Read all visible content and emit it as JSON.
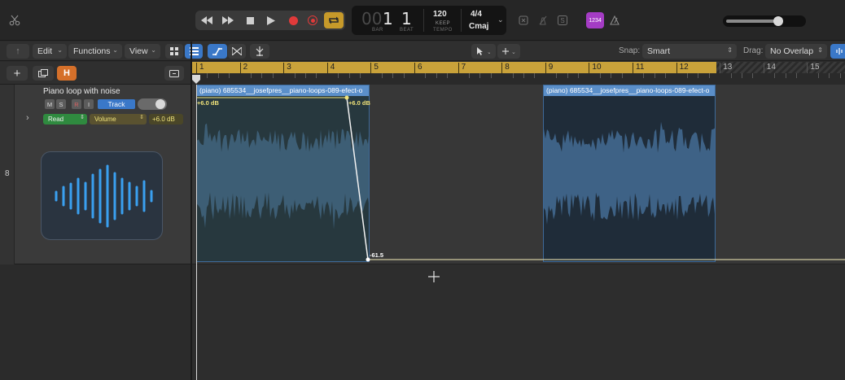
{
  "control_bar": {
    "scissors_icon": "scissors-icon",
    "transport": {
      "rewind": "rewind-icon",
      "forward": "fast-forward-icon",
      "stop": "stop-icon",
      "play": "play-icon",
      "record": "record-icon",
      "capture": "capture-record-icon",
      "cycle": "cycle-icon"
    },
    "lcd": {
      "position_dim": "00",
      "bar": "1",
      "beat": "1",
      "bar_label": "BAR",
      "beat_label": "BEAT",
      "tempo": "120",
      "tempo_mode": "KEEP",
      "tempo_label": "TEMPO",
      "signature": "4/4",
      "key": "Cmaj"
    },
    "count_in": "1234",
    "colors": {
      "record": "#e03a3a",
      "cycle": "#c79a2a",
      "count_in": "#a43cc4"
    }
  },
  "tracks_toolbar": {
    "edit_label": "Edit",
    "functions_label": "Functions",
    "view_label": "View",
    "snap_label": "Snap:",
    "snap_value": "Smart",
    "drag_label": "Drag:",
    "drag_value": "No Overlap"
  },
  "header_strip": {
    "global_tracks_letter": "H"
  },
  "ruler": {
    "bars": [
      "1",
      "2",
      "3",
      "4",
      "5",
      "6",
      "7",
      "8",
      "9",
      "10",
      "11",
      "12",
      "13",
      "14",
      "15"
    ],
    "cycle_color": "#c9a23a"
  },
  "track": {
    "number": "8",
    "name": "Piano loop with noise",
    "mute": "M",
    "solo": "S",
    "record": "R",
    "input": "I",
    "track_button": "Track",
    "automation_mode": "Read",
    "automation_param": "Volume",
    "automation_value": "+6.0 dB"
  },
  "regions": [
    {
      "title": "(piano) 685534__josefpres__piano-loops-089-efect-o"
    },
    {
      "title": "(piano) 685534__josefpres__piano-loops-089-efect-o"
    }
  ],
  "automation": {
    "start_label": "+6.0 dB",
    "peak_label": "+6.0 dB",
    "end_label": "-61.5"
  }
}
